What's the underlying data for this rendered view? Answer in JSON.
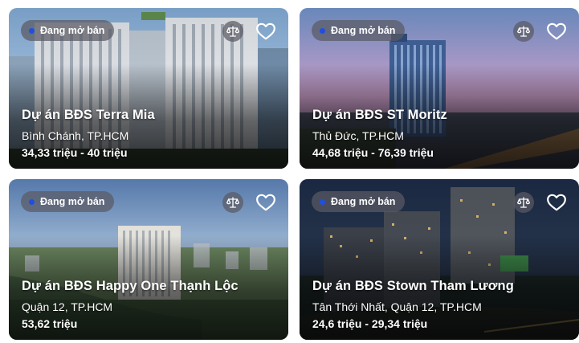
{
  "projects": [
    {
      "status": "Đang mở bán",
      "title": "Dự án BĐS Terra Mia",
      "location": "Bình Chánh, TP.HCM",
      "price": "34,33 triệu - 40 triệu"
    },
    {
      "status": "Đang mở bán",
      "title": "Dự án BĐS ST Moritz",
      "location": "Thủ Đức, TP.HCM",
      "price": "44,68 triệu - 76,39 triệu"
    },
    {
      "status": "Đang mở bán",
      "title": "Dự án BĐS Happy One Thạnh Lộc",
      "location": "Quận 12, TP.HCM",
      "price": "53,62 triệu"
    },
    {
      "status": "Đang mở bán",
      "title": "Dự án BĐS Stown Tham Lương",
      "location": "Tân Thới Nhất, Quận 12, TP.HCM",
      "price": "24,6 triệu - 29,34 triệu"
    }
  ],
  "colors": {
    "status_dot": "#1f4fe0",
    "badge_bg": "rgba(90,90,100,0.72)"
  },
  "icons": {
    "compare": "scale-icon",
    "favorite": "heart-icon"
  }
}
